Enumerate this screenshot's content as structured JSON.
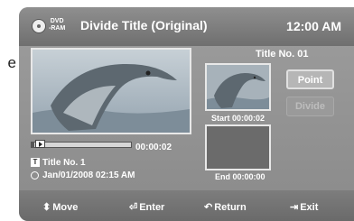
{
  "side_text": "e",
  "header": {
    "disc_line1": "DVD",
    "disc_line2": "-RAM",
    "title": "Divide Title (Original)",
    "clock": "12:00 AM"
  },
  "player": {
    "timecode": "00:00:02",
    "progress": 0.03,
    "title_label": "Title No. 1",
    "date": "Jan/01/2008  02:15 AM"
  },
  "divide": {
    "title_no": "Title No. 01",
    "start": "Start 00:00:02",
    "end": "End 00:00:00",
    "point_label": "Point",
    "divide_label": "Divide"
  },
  "footer": {
    "move": "Move",
    "enter": "Enter",
    "return": "Return",
    "exit": "Exit"
  },
  "colors": {
    "header_bg": "#7f7f7f",
    "body_bg": "#929292",
    "text": "#ffffff"
  }
}
